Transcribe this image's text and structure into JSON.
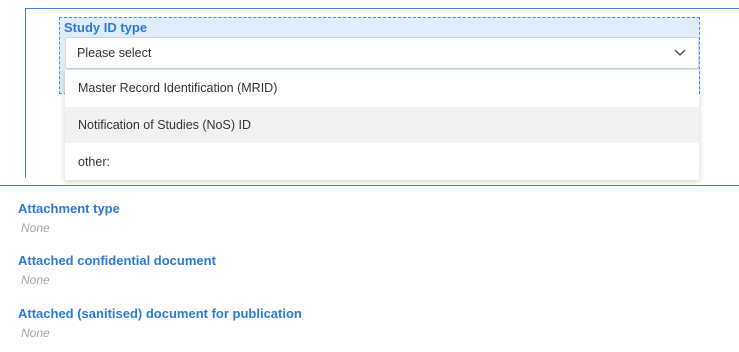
{
  "study_id": {
    "label": "Study ID type",
    "placeholder": "Please select",
    "close_label": "close",
    "options": [
      "Master Record Identification (MRID)",
      "Notification of Studies (NoS) ID",
      "other:"
    ]
  },
  "sections": [
    {
      "label": "Attachment type",
      "value": "None"
    },
    {
      "label": "Attached confidential document",
      "value": "None"
    },
    {
      "label": "Attached (sanitised) document for publication",
      "value": "None"
    }
  ],
  "colors": {
    "accent": "#2d7ad6",
    "highlight": "#dfedfb"
  }
}
